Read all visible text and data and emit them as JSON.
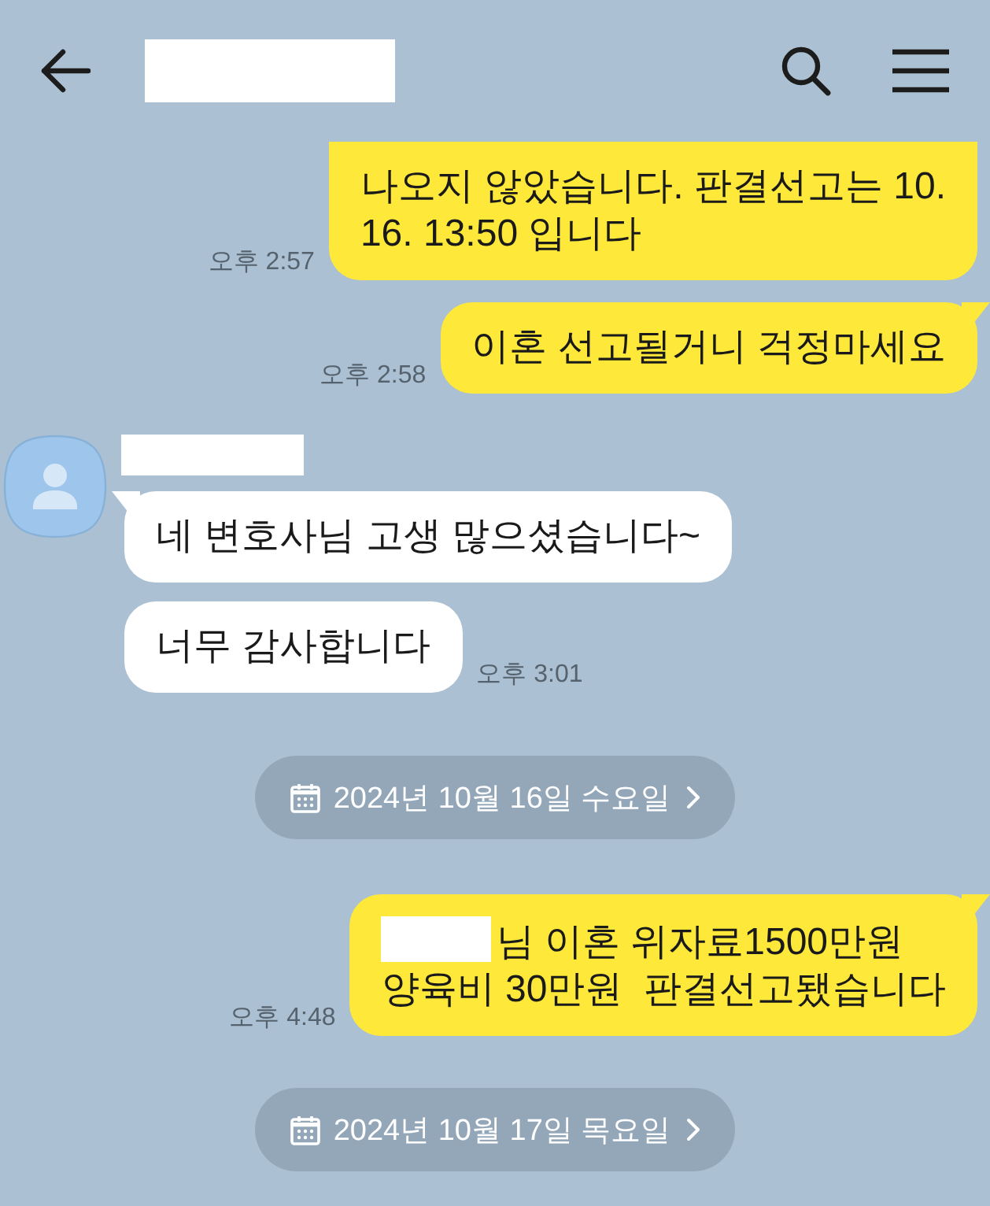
{
  "header": {
    "title_redacted": true
  },
  "chat": [
    {
      "kind": "sent",
      "cut_off": true,
      "time": "오후 2:57",
      "bubbles": [
        {
          "redacted_prefix": false,
          "text": "나오지 않았습니다. 판결선고는 10.\n16. 13:50 입니다"
        }
      ]
    },
    {
      "kind": "sent",
      "cut_off": false,
      "time": "오후 2:58",
      "bubbles": [
        {
          "redacted_prefix": false,
          "text": "이혼 선고될거니 걱정마세요"
        }
      ]
    },
    {
      "kind": "received",
      "cut_off": false,
      "sender_redacted": true,
      "time": "오후 3:01",
      "bubbles": [
        {
          "redacted_prefix": false,
          "text": "네 변호사님 고생 많으셨습니다~"
        },
        {
          "redacted_prefix": false,
          "text": "너무 감사합니다"
        }
      ]
    },
    {
      "kind": "date",
      "text": "2024년 10월 16일 수요일"
    },
    {
      "kind": "sent",
      "cut_off": false,
      "time": "오후 4:48",
      "bubbles": [
        {
          "redacted_prefix": true,
          "text": "님 이혼 위자료1500만원\n양육비 30만원  판결선고됐습니다"
        }
      ]
    },
    {
      "kind": "date",
      "text": "2024년 10월 17일 목요일"
    }
  ]
}
